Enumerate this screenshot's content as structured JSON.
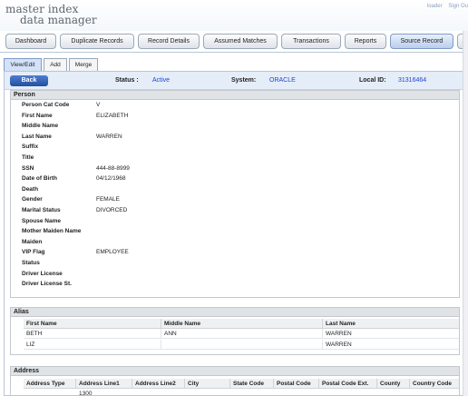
{
  "app": {
    "logo_top": "master index",
    "logo_bottom": "data manager",
    "user": "loader",
    "signout": "Sign Ou"
  },
  "nav": {
    "dashboard": "Dashboard",
    "duplicates": "Duplicate Records",
    "record_details": "Record Details",
    "assumed": "Assumed Matches",
    "transactions": "Transactions",
    "reports": "Reports",
    "source_record": "Source Record",
    "more": "A"
  },
  "subtabs": {
    "view_edit": "View/Edit",
    "add": "Add",
    "merge": "Merge"
  },
  "status_bar": {
    "back": "Back",
    "status_label": "Status :",
    "status_value": "Active",
    "system_label": "System:",
    "system_value": "ORACLE",
    "localid_label": "Local ID:",
    "localid_value": "31316464"
  },
  "person": {
    "heading": "Person",
    "fields": [
      {
        "label": "Person Cat Code",
        "value": "V"
      },
      {
        "label": "First Name",
        "value": "ELIZABETH"
      },
      {
        "label": "Middle Name",
        "value": ""
      },
      {
        "label": "Last Name",
        "value": "WARREN"
      },
      {
        "label": "Suffix",
        "value": ""
      },
      {
        "label": "Title",
        "value": ""
      },
      {
        "label": "SSN",
        "value": "444-88-8999"
      },
      {
        "label": "Date of Birth",
        "value": "04/12/1968"
      },
      {
        "label": "Death",
        "value": ""
      },
      {
        "label": "Gender",
        "value": "FEMALE"
      },
      {
        "label": "Marital Status",
        "value": "DIVORCED"
      },
      {
        "label": "Spouse Name",
        "value": ""
      },
      {
        "label": "Mother Maiden Name",
        "value": ""
      },
      {
        "label": "Maiden",
        "value": ""
      },
      {
        "label": "VIP Flag",
        "value": "EMPLOYEE"
      },
      {
        "label": "Status",
        "value": ""
      },
      {
        "label": "Driver License",
        "value": ""
      },
      {
        "label": "Driver License St.",
        "value": ""
      }
    ]
  },
  "alias": {
    "heading": "Alias",
    "columns": [
      "First Name",
      "Middle Name",
      "Last Name"
    ],
    "rows": [
      [
        "BETH",
        "ANN",
        "WARREN"
      ],
      [
        "LIZ",
        "",
        "WARREN"
      ]
    ]
  },
  "address": {
    "heading": "Address",
    "columns": [
      "Address Type",
      "Address Line1",
      "Address Line2",
      "City",
      "State Code",
      "Postal Code",
      "Postal Code Ext.",
      "County",
      "Country Code"
    ],
    "rows": [
      [
        "",
        "1300",
        "",
        "",
        "",
        "",
        "",
        "",
        ""
      ]
    ]
  }
}
